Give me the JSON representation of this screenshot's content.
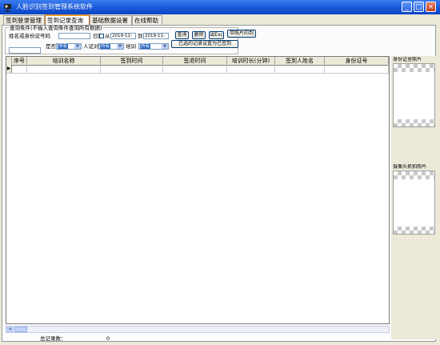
{
  "window": {
    "title": "人脸识别签到管理系统软件",
    "buttons": {
      "minimize": "_",
      "maximize": "□",
      "close": "×"
    }
  },
  "tabs": [
    {
      "label": "签到登录管理",
      "active": false
    },
    {
      "label": "签到记录查询",
      "active": true
    },
    {
      "label": "基础数据设置",
      "active": false
    },
    {
      "label": "在线帮助",
      "active": false
    }
  ],
  "query": {
    "legend": "查询条件(不输入查询条件查询所有数据)",
    "name_or_id_label": "姓名或身份证号码",
    "name_or_id_value": "",
    "date_label": "日期",
    "date_from_label": "从",
    "date_from_value": "2019-11-",
    "date_to_label": "到",
    "date_to_value": "2019-11-",
    "late_label": "是否",
    "late_value": "所有",
    "id_label": "人证对",
    "id_value": "所有",
    "train_label": "培训",
    "train_value": "所有"
  },
  "buttons": {
    "query": "查询",
    "delete": "删除",
    "export": "出Exc",
    "export_photo": "带照片的到",
    "set_signed": "已选的记录设置为已签到"
  },
  "grid": {
    "columns": [
      "序号",
      "培训名称",
      "签到时间",
      "签退时间",
      "培训时长(分钟)",
      "签到人姓名",
      "身份证号"
    ],
    "row_indicator": "▶",
    "scroll_left": "◂"
  },
  "footer": {
    "total_label": "总记录数：",
    "total_value": "0"
  },
  "side": {
    "id_photo_label": "身份证里照片",
    "camera_photo_label": "摄像头抓拍照片"
  }
}
